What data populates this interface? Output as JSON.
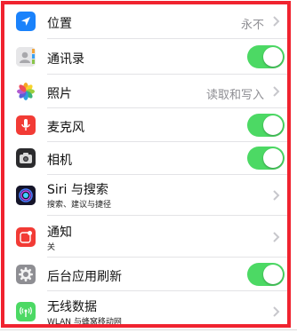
{
  "rows": [
    {
      "icon": "location-arrow-icon",
      "title": "位置",
      "detail": "永不"
    },
    {
      "icon": "contacts-icon",
      "title": "通讯录",
      "toggle_on": true
    },
    {
      "icon": "photos-icon",
      "title": "照片",
      "detail": "读取和写入"
    },
    {
      "icon": "microphone-icon",
      "title": "麦克风",
      "toggle_on": true
    },
    {
      "icon": "camera-icon",
      "title": "相机",
      "toggle_on": true
    },
    {
      "icon": "siri-icon",
      "title": "Siri 与搜索",
      "subtitle": "搜索、建议与捷径"
    },
    {
      "icon": "notifications-icon",
      "title": "通知",
      "subtitle": "关"
    },
    {
      "icon": "gear-icon",
      "title": "后台应用刷新",
      "toggle_on": true
    },
    {
      "icon": "wireless-data-icon",
      "title": "无线数据",
      "subtitle": "WLAN 与蜂窝移动网"
    }
  ],
  "colors": {
    "toggle_on": "#4cd964",
    "highlight_border": "#f0232f",
    "location_icon_bg": "#1a82fb",
    "mic_icon_bg": "#f23b35",
    "camera_icon_bg": "#2b2b2d",
    "notifications_icon_bg": "#f23b35",
    "gear_icon_bg": "#8e8e93",
    "wireless_icon_bg": "#4cd964"
  }
}
